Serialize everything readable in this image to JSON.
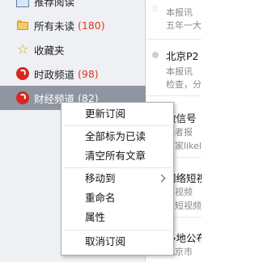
{
  "sidebar": {
    "items": [
      {
        "label": "推荐阅读",
        "count": "",
        "icon": "star-list-icon"
      },
      {
        "label": "所有未读",
        "count": "(180)",
        "icon": "folder-icon"
      },
      {
        "label": "收藏夹",
        "count": "",
        "icon": "star-icon"
      },
      {
        "label": "时政频道",
        "count": "(98)",
        "icon": "feed-icon"
      },
      {
        "label": "财经频道",
        "count": "(82)",
        "icon": "feed-icon"
      }
    ]
  },
  "articles": [
    {
      "title": "",
      "sub1": "本报讯",
      "sub2": "五年一大"
    },
    {
      "title": "北京P2",
      "sub1": "本报讯",
      "sub2": "检查，分"
    },
    {
      "title": "微信号",
      "sub1": "记者报",
      "sub2": "商家likely"
    },
    {
      "title": "网络短视",
      "sub1": "短视频",
      "sub2": "，短视频"
    },
    {
      "title": "多地公布",
      "sub1": "北京市",
      "sub2": ""
    }
  ],
  "context_menu": {
    "items": [
      "更新订阅",
      "全部标为已读",
      "清空所有文章",
      "移动到",
      "重命名",
      "属性",
      "取消订阅"
    ]
  },
  "colors": {
    "selected_bg": "#8f95a1",
    "count_red": "#e0341e",
    "sidebar_bg": "#eef0f3"
  }
}
